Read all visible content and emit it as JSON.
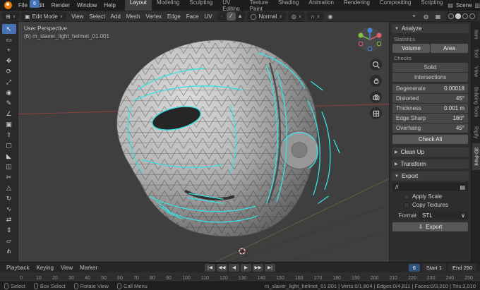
{
  "topbar": {
    "menus": [
      "File",
      "Edit",
      "Render",
      "Window",
      "Help"
    ],
    "workspaces": [
      {
        "label": "Layout",
        "active": true
      },
      {
        "label": "Modeling"
      },
      {
        "label": "Sculpting"
      },
      {
        "label": "UV Editing"
      },
      {
        "label": "Texture Paint"
      },
      {
        "label": "Shading"
      },
      {
        "label": "Animation"
      },
      {
        "label": "Rendering"
      },
      {
        "label": "Compositing"
      },
      {
        "label": "Scripting"
      }
    ],
    "scene_label": "Scene"
  },
  "viewport_header": {
    "mode": "Edit Mode",
    "menus": [
      "View",
      "Select",
      "Add",
      "Mesh",
      "Vertex",
      "Edge",
      "Face",
      "UV"
    ],
    "select_modes": [
      {
        "name": "vertex",
        "glyph": "∙"
      },
      {
        "name": "edge",
        "glyph": "∕",
        "active": true
      },
      {
        "name": "face",
        "glyph": "▲"
      }
    ],
    "orientation": "Normal"
  },
  "viewport": {
    "overlay_line1": "User Perspective",
    "overlay_line2": "(6) m_slaver_light_helmet_01.001"
  },
  "toolbar": {
    "tools": [
      {
        "name": "tweak",
        "glyph": "↖",
        "active": true
      },
      {
        "name": "select-box",
        "glyph": "▭"
      },
      {
        "name": "cursor",
        "glyph": "+"
      },
      {
        "name": "move",
        "glyph": "✥"
      },
      {
        "name": "rotate",
        "glyph": "⟳"
      },
      {
        "name": "scale",
        "glyph": "⤢"
      },
      {
        "name": "transform",
        "glyph": "◉"
      },
      {
        "name": "annotate",
        "glyph": "✎"
      },
      {
        "name": "measure",
        "glyph": "∠"
      },
      {
        "name": "add-cube",
        "glyph": "▣"
      },
      {
        "name": "extrude",
        "glyph": "⇧"
      },
      {
        "name": "inset",
        "glyph": "▢"
      },
      {
        "name": "bevel",
        "glyph": "◣"
      },
      {
        "name": "loop-cut",
        "glyph": "◫"
      },
      {
        "name": "knife",
        "glyph": "✂"
      },
      {
        "name": "poly-build",
        "glyph": "△"
      },
      {
        "name": "spin",
        "glyph": "↻"
      },
      {
        "name": "smooth",
        "glyph": "∿"
      },
      {
        "name": "edge-slide",
        "glyph": "⇄"
      },
      {
        "name": "shrink-fatten",
        "glyph": "⇕"
      },
      {
        "name": "shear",
        "glyph": "▱"
      },
      {
        "name": "rip",
        "glyph": "⋔"
      }
    ]
  },
  "sidebar": {
    "tabs": [
      {
        "label": "Item"
      },
      {
        "label": "Tool"
      },
      {
        "label": "View"
      },
      {
        "label": "Building Tools"
      },
      {
        "label": "Rigify"
      },
      {
        "label": "3D-Print",
        "active": true
      }
    ],
    "analyze": {
      "title": "Analyze",
      "statistics_label": "Statistics",
      "volume_button": "Volume",
      "area_button": "Area",
      "checks_label": "Checks",
      "solid_button": "Solid",
      "intersections_button": "Intersections",
      "checks": [
        {
          "label": "Degenerate",
          "value": "0.00018"
        },
        {
          "label": "Distorted",
          "value": "45°"
        },
        {
          "label": "Thickness",
          "value": "0.001 m"
        },
        {
          "label": "Edge Sharp",
          "value": "160°"
        },
        {
          "label": "Overhang",
          "value": "45°"
        }
      ],
      "check_all_button": "Check All"
    },
    "cleanup_title": "Clean Up",
    "transform_title": "Transform",
    "export": {
      "title": "Export",
      "path_value": "//",
      "apply_scale_label": "Apply Scale",
      "copy_textures_label": "Copy Textures",
      "format_label": "Format",
      "format_value": "STL",
      "export_button": "Export"
    }
  },
  "timeline": {
    "menus": [
      "Playback",
      "Keying",
      "View",
      "Marker"
    ],
    "transport": [
      {
        "name": "jump-to-start",
        "glyph": "|◀"
      },
      {
        "name": "prev-keyframe",
        "glyph": "◀◀"
      },
      {
        "name": "play-reverse",
        "glyph": "◀"
      },
      {
        "name": "play",
        "glyph": "▶"
      },
      {
        "name": "next-keyframe",
        "glyph": "▶▶"
      },
      {
        "name": "jump-to-end",
        "glyph": "▶|"
      }
    ],
    "current_frame": "6",
    "start_label": "Start",
    "start_value": "1",
    "end_label": "End",
    "end_value": "250",
    "ticks": [
      "0",
      "10",
      "20",
      "30",
      "40",
      "50",
      "60",
      "70",
      "80",
      "90",
      "100",
      "110",
      "120",
      "130",
      "140",
      "150",
      "160",
      "170",
      "180",
      "190",
      "200",
      "210",
      "220",
      "230",
      "240",
      "250"
    ]
  },
  "statusbar": {
    "hints": [
      "Select",
      "Box Select",
      "Rotate View",
      "Call Menu"
    ],
    "stats": "m_slaver_light_helmet_01.001 | Verts:0/1,804 | Edges:0/4,811 | Faces:0/3,010 | Tris:3,010"
  },
  "icons": {
    "editor_type": "⊞",
    "mode_icon": "▣",
    "caret": "∨",
    "globe": "◯",
    "pivot": "◎",
    "magnet": "∩",
    "proportional": "◉",
    "gizmo_toggle": "⌖",
    "overlays": "◍",
    "xray": "▦",
    "scene": "▤",
    "view_layer": "▥",
    "folder": "▤",
    "export_arrow": "⇩",
    "section_open": "▼",
    "section_closed": "▶"
  },
  "colors": {
    "accent": "#4772b3",
    "selection_cyan": "#38e2e3",
    "axis_x": "#8a4040",
    "axis_y": "#55663c"
  }
}
